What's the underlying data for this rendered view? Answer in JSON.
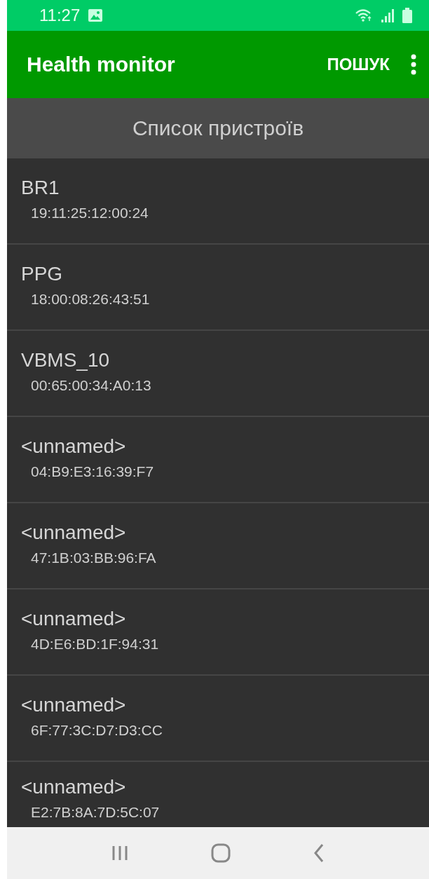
{
  "status_bar": {
    "time": "11:27"
  },
  "app_bar": {
    "title": "Health monitor",
    "action": "ПОШУК"
  },
  "list_header": "Список пристроїв",
  "devices": [
    {
      "name": "BR1",
      "address": "19:11:25:12:00:24"
    },
    {
      "name": "PPG",
      "address": "18:00:08:26:43:51"
    },
    {
      "name": "VBMS_10",
      "address": "00:65:00:34:A0:13"
    },
    {
      "name": "<unnamed>",
      "address": "04:B9:E3:16:39:F7"
    },
    {
      "name": "<unnamed>",
      "address": "47:1B:03:BB:96:FA"
    },
    {
      "name": "<unnamed>",
      "address": "4D:E6:BD:1F:94:31"
    },
    {
      "name": "<unnamed>",
      "address": "6F:77:3C:D7:D3:CC"
    },
    {
      "name": "<unnamed>",
      "address": "E2:7B:8A:7D:5C:07"
    }
  ]
}
